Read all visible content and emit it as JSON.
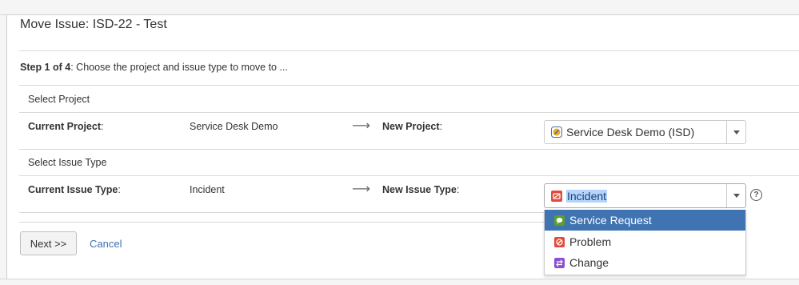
{
  "dialog": {
    "title": "Move Issue: ISD-22 - Test",
    "step_bold": "Step 1 of 4",
    "step_text": ": Choose the project and issue type to move to ..."
  },
  "project_section": {
    "title": "Select Project",
    "current_label": "Current Project",
    "current_label_suffix": ":",
    "current_value": "Service Desk Demo",
    "arrow": "⟶",
    "new_label": "New Project",
    "new_label_suffix": ":",
    "new_value": "Service Desk Demo (ISD)",
    "new_icon": "project-avatar-icon"
  },
  "issue_type_section": {
    "title": "Select Issue Type",
    "current_label": "Current Issue Type",
    "current_label_suffix": ":",
    "current_value": "Incident",
    "arrow": "⟶",
    "new_label": "New Issue Type",
    "new_label_suffix": ":",
    "new_value": "Incident",
    "new_icon": "incident-icon",
    "help": "?"
  },
  "dropdown": {
    "options": [
      {
        "label": "Service Request",
        "icon": "service-request-icon",
        "color": "#5aa02c",
        "selected": true
      },
      {
        "label": "Problem",
        "icon": "problem-icon",
        "color": "#e5493a",
        "selected": false
      },
      {
        "label": "Change",
        "icon": "change-icon",
        "color": "#8b4fcf",
        "selected": false
      }
    ]
  },
  "actions": {
    "next_label": "Next >>",
    "cancel_label": "Cancel"
  },
  "colors": {
    "link": "#3b73af",
    "dropdown_active_bg": "#3f73b1",
    "selection_highlight": "#b3d4fc"
  }
}
